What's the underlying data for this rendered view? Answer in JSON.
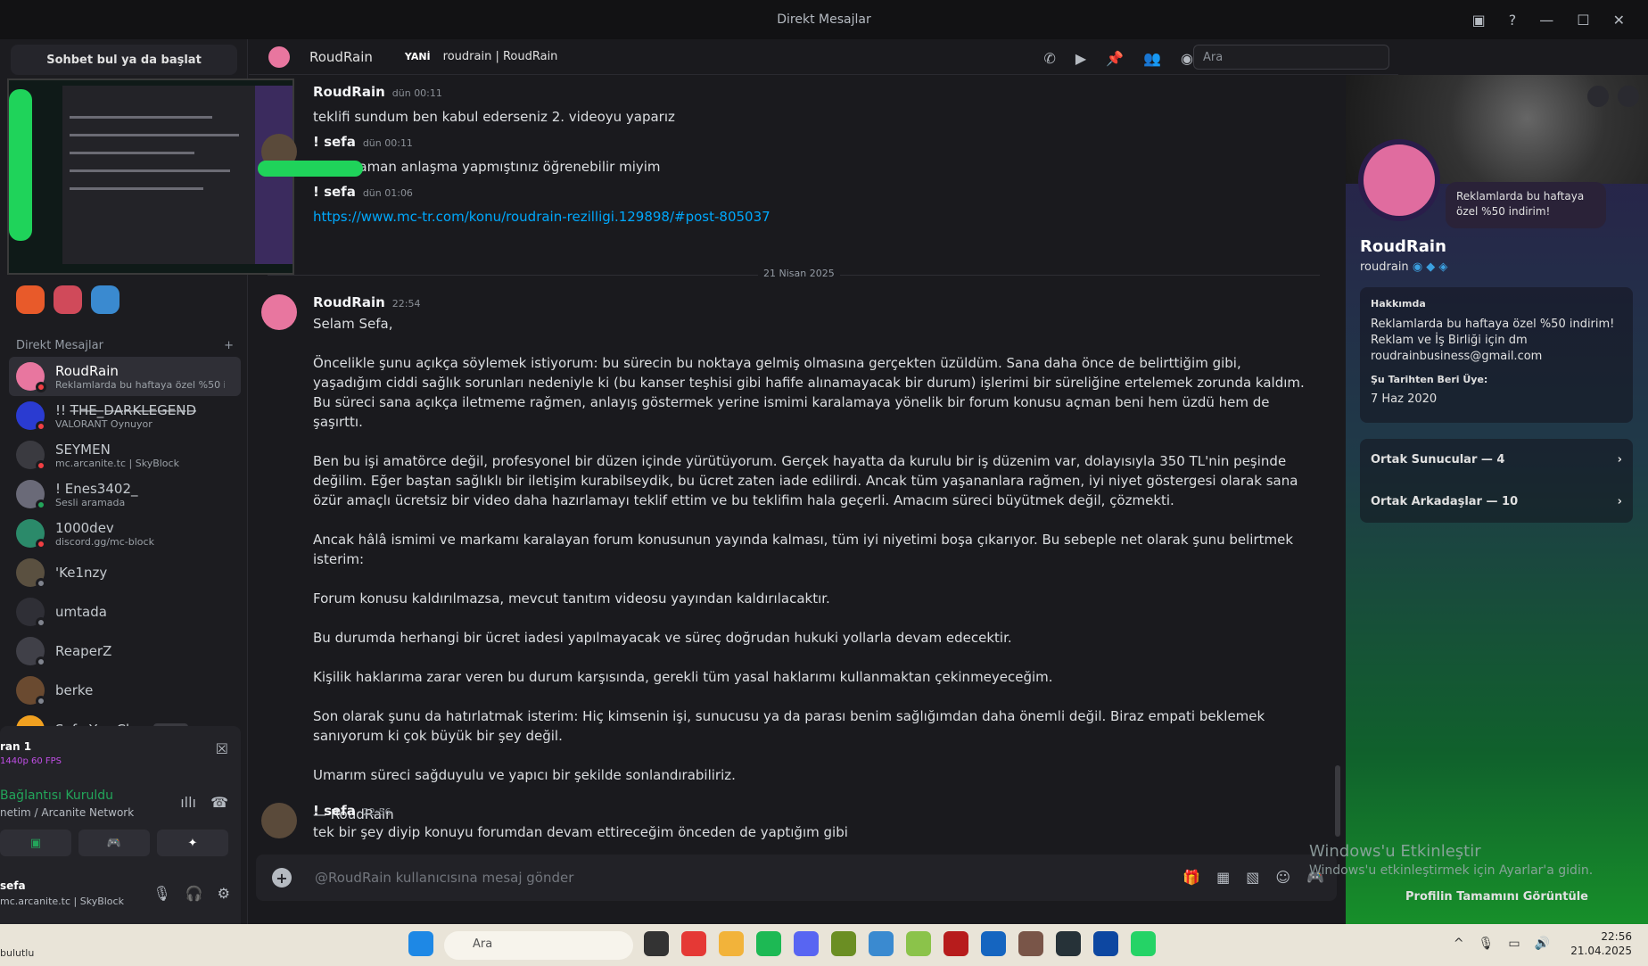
{
  "window": {
    "title": "Direkt Mesajlar"
  },
  "sidebar": {
    "search_button": "Sohbet bul ya da başlat",
    "dm_header": "Direkt Mesajlar",
    "dms": [
      {
        "name": "RoudRain",
        "sub": "Reklamlarda bu haftaya özel %50 i...",
        "color": "#e8769f",
        "status": "#f23f43"
      },
      {
        "name": "!! T̶H̶E̶_̶D̶A̶R̶K̶L̶E̶G̶E̶N̶D̶",
        "sub": "VALORANT Oynuyor",
        "color": "#2a3bd1",
        "status": "#f23f43"
      },
      {
        "name": "SEYMEN",
        "sub": "mc.arcanite.tc | SkyBlock",
        "color": "#3a3a40",
        "status": "#f23f43"
      },
      {
        "name": "! Enes3402_",
        "sub": "Sesli aramada",
        "color": "#6a6a78",
        "status": "#23a55a"
      },
      {
        "name": "1000dev",
        "sub": "discord.gg/mc-block",
        "color": "#2b8a6a",
        "status": "#f23f43"
      },
      {
        "name": "'Ke1nzy",
        "sub": "",
        "color": "#5a5040",
        "status": "#80848e"
      },
      {
        "name": "umtada",
        "sub": "",
        "color": "#2f2f36",
        "status": "#80848e"
      },
      {
        "name": "ReaperZ",
        "sub": "",
        "color": "#404048",
        "status": "#80848e"
      },
      {
        "name": "berke",
        "sub": "",
        "color": "#6a4a30",
        "status": "#80848e"
      },
      {
        "name": "Sefa Yan Char",
        "sub": "",
        "badge": "⚡DEV",
        "color": "#f0a020",
        "status": "#80848e"
      }
    ],
    "voice": {
      "stream": "ran 1",
      "stream_quality": "1440p 60 FPS",
      "status": "Bağlantısı Kuruldu",
      "channel": "netim / Arcanite Network",
      "user": "sefa",
      "user_status": "mc.arcanite.tc | SkyBlock"
    }
  },
  "header": {
    "name": "RoudRain",
    "aka": "YANİ",
    "alias": "roudrain | RoudRain",
    "search_placeholder": "Ara"
  },
  "messages": {
    "m1_author": "RoudRain",
    "m1_time": "dün 00:11",
    "m1_text": "teklifi sundum ben kabul ederseniz 2. videoyu yaparız",
    "m2_author": "! sefa",
    "m2_time": "dün 00:11",
    "m2_text": "ne zaman anlaşma yapmıştınız öğrenebilir miyim",
    "m3_author": "! sefa",
    "m3_time": "dün 01:06",
    "m3_link": "https://www.mc-tr.com/konu/roudrain-rezilligi.129898/#post-805037",
    "divider": "21 Nisan 2025",
    "m4_author": "RoudRain",
    "m4_time": "22:54",
    "m4_p": [
      "Selam Sefa,",
      "Öncelikle şunu açıkça söylemek istiyorum: bu sürecin bu noktaya gelmiş olmasına gerçekten üzüldüm. Sana daha önce de belirttiğim gibi, yaşadığım ciddi sağlık sorunları nedeniyle ki (bu kanser teşhisi gibi hafife alınamayacak bir durum) işlerimi bir süreliğine ertelemek zorunda kaldım. Bu süreci sana açıkça iletmeme rağmen, anlayış göstermek yerine ismimi karalamaya yönelik bir forum konusu açman beni hem üzdü hem de şaşırttı.",
      "Ben bu işi amatörce değil, profesyonel bir düzen içinde yürütüyorum. Gerçek hayatta da kurulu bir iş düzenim var, dolayısıyla 350 TL'nin peşinde değilim. Eğer baştan sağlıklı bir iletişim kurabilseydik, bu ücret zaten iade edilirdi. Ancak tüm yaşananlara rağmen, iyi niyet göstergesi olarak sana özür amaçlı ücretsiz bir video daha hazırlamayı teklif ettim ve bu teklifim hala geçerli. Amacım süreci büyütmek değil, çözmekti.",
      "Ancak hâlâ ismimi ve markamı karalayan forum konusunun yayında kalması, tüm iyi niyetimi boşa çıkarıyor. Bu sebeple net olarak şunu belirtmek isterim:",
      "Forum konusu kaldırılmazsa, mevcut tanıtım videosu yayından kaldırılacaktır.",
      "Bu durumda herhangi bir ücret iadesi yapılmayacak ve süreç doğrudan hukuki yollarla devam edecektir.",
      "Kişilik haklarıma zarar veren bu durum karşısında, gerekli tüm yasal haklarımı kullanmaktan çekinmeyeceğim.",
      "Son olarak şunu da hatırlatmak isterim: Hiç kimsenin işi, sunucusu ya da parası benim sağlığımdan daha önemli değil. Biraz empati beklemek sanıyorum ki çok büyük bir şey değil.",
      "Umarım süreci sağduyulu ve yapıcı bir şekilde sonlandırabiliriz.",
      "— RoudRain"
    ],
    "m5_author": "! sefa",
    "m5_time": "22:56",
    "m5_text": "tek bir şey diyip konuyu forumdan devam ettireceğim önceden de yaptığım gibi"
  },
  "composer": {
    "placeholder": "@RoudRain kullanıcısına mesaj gönder"
  },
  "profile": {
    "bubble": "Reklamlarda bu haftaya özel %50 indirim!",
    "name": "RoudRain",
    "username": "roudrain",
    "about_h": "Hakkımda",
    "about": "Reklamlarda bu haftaya özel %50 indirim! Reklam ve İş Birliği için dm roudrainbusiness@gmail.com",
    "member_h": "Şu Tarihten Beri Üye:",
    "member_since": "7 Haz 2020",
    "servers": "Ortak Sunucular — 4",
    "friends": "Ortak Arkadaşlar — 10",
    "full": "Profilin Tamamını Görüntüle"
  },
  "watermark": {
    "l1": "Windows'u Etkinleştir",
    "l2": "Windows'u etkinleştirmek için Ayarlar'a gidin."
  },
  "taskbar": {
    "search": "Ara",
    "left": "bulutlu",
    "time": "22:56",
    "date": "21.04.2025"
  }
}
